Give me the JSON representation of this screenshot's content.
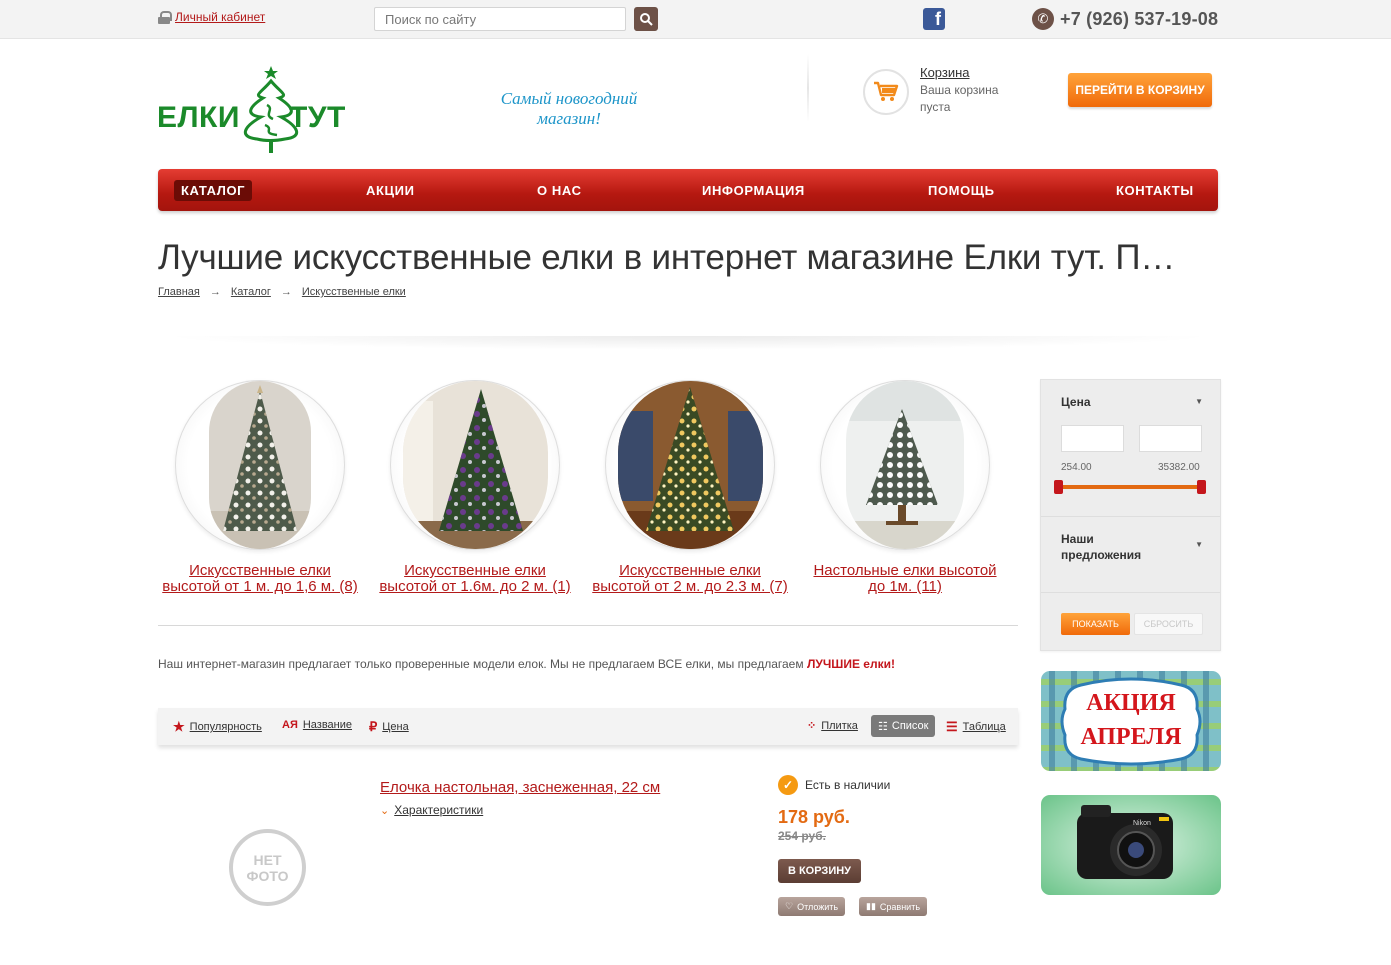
{
  "topbar": {
    "cabinet_label": "Личный кабинет",
    "search_placeholder": "Поиск по сайту",
    "facebook_letter": "f",
    "phone": "+7 (926) 537-19-08"
  },
  "header": {
    "logo_left": "ЕЛКИ",
    "logo_right": "ТУТ",
    "slogan_line1": "Самый новогодний",
    "slogan_line2": "магазин!",
    "cart_title": "Корзина",
    "cart_status_line1": "Ваша корзина",
    "cart_status_line2": "пуста",
    "go_to_cart": "ПЕРЕЙТИ В КОРЗИНУ"
  },
  "nav": {
    "items": [
      "КАТАЛОГ",
      "АКЦИИ",
      "О НАС",
      "ИНФОРМАЦИЯ",
      "ПОМОЩЬ",
      "КОНТАКТЫ"
    ],
    "active": "КАТАЛОГ"
  },
  "page": {
    "title": "Лучшие искусственные елки в интернет магазине Елки тут. П…",
    "breadcrumb": [
      "Главная",
      "Каталог",
      "Искусственные елки"
    ],
    "breadcrumb_sep": "→"
  },
  "categories": [
    {
      "line1": "Искусственные елки",
      "line2": "высотой от 1 м. до 1,6 м. (8)"
    },
    {
      "line1": "Искусственные елки",
      "line2": "высотой от 1.6м. до 2 м. (1)"
    },
    {
      "line1": "Искусственные елки",
      "line2": "высотой от 2 м. до 2.3 м. (7)"
    },
    {
      "line1": "Настольные елки высотой",
      "line2": "до 1м. (11)"
    }
  ],
  "intro": {
    "text": "Наш интернет-магазин предлагает только проверенные модели елок. Мы не предлагаем ВСЕ елки, мы предлагаем ",
    "highlight": "ЛУЧШИЕ елки!"
  },
  "sortbar": {
    "popularity": "Популярность",
    "name": "Название",
    "price": "Цена",
    "view_tile": "Плитка",
    "view_list": "Список",
    "view_table": "Таблица",
    "active_view": "Список"
  },
  "product": {
    "no_photo_line1": "НЕТ",
    "no_photo_line2": "ФОТО",
    "name": "Елочка настольная, заснеженная, 22 см",
    "characteristics": "Характеристики",
    "stock": "Есть в наличии",
    "price": "178 руб.",
    "old_price": "254 руб.",
    "to_cart": "В КОРЗИНУ",
    "postpone": "Отложить",
    "compare": "Сравнить"
  },
  "filter": {
    "price_title": "Цена",
    "min_value": "254.00",
    "max_value": "35382.00",
    "offers_line1": "Наши",
    "offers_line2": "предложения",
    "show": "ПОКАЗАТЬ",
    "reset": "СБРОСИТЬ"
  },
  "banners": {
    "promo_line1": "АКЦИЯ",
    "promo_line2": "АПРЕЛЯ",
    "camera_brand": "Nikon"
  },
  "colors": {
    "accent_red": "#b31a1a",
    "nav_red": "#c4261c",
    "orange": "#f28a1a",
    "logo_green": "#1b8a2a",
    "slogan_blue": "#1d95c9",
    "brown_button": "#6d5147"
  },
  "icons": [
    "lock-icon",
    "search-icon",
    "facebook-icon",
    "phone-icon",
    "cart-icon",
    "star-icon",
    "sort-az-icon",
    "ruble-icon",
    "tile-icon",
    "list-icon",
    "table-icon",
    "check-icon",
    "heart-icon",
    "compare-icon",
    "chevron-down-icon"
  ]
}
